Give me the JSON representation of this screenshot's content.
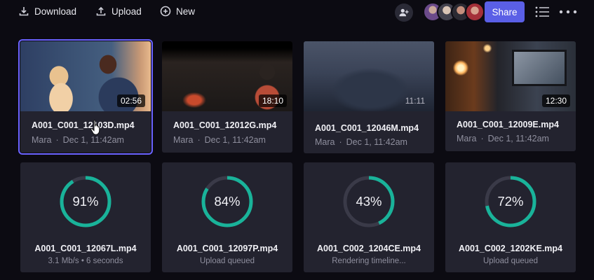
{
  "toolbar": {
    "download_label": "Download",
    "upload_label": "Upload",
    "new_label": "New",
    "share_label": "Share"
  },
  "colors": {
    "accent": "#5a5fe6",
    "progress": "#19b39a",
    "track": "#3a3a48",
    "selection": "#6a62ff"
  },
  "clips": [
    {
      "name": "A001_C001_12103D.mp4",
      "owner": "Mara",
      "date": "Dec 1, 11:42am",
      "duration": "02:56",
      "selected": true
    },
    {
      "name": "A001_C001_12012G.mp4",
      "owner": "Mara",
      "date": "Dec 1, 11:42am",
      "duration": "18:10",
      "selected": false
    },
    {
      "name": "A001_C001_12046M.mp4",
      "owner": "Mara",
      "date": "Dec 1, 11:42am",
      "duration": "11:11",
      "selected": false
    },
    {
      "name": "A001_C001_12009E.mp4",
      "owner": "Mara",
      "date": "Dec 1, 11:42am",
      "duration": "12:30",
      "selected": false
    }
  ],
  "uploads": [
    {
      "name": "A001_C001_12067L.mp4",
      "percent": 91,
      "percent_label": "91%",
      "status": "3.1 Mb/s  •  6 seconds"
    },
    {
      "name": "A001_C001_12097P.mp4",
      "percent": 84,
      "percent_label": "84%",
      "status": "Upload queued"
    },
    {
      "name": "A001_C002_1204CE.mp4",
      "percent": 43,
      "percent_label": "43%",
      "status": "Rendering timeline..."
    },
    {
      "name": "A001_C002_1202KE.mp4",
      "percent": 72,
      "percent_label": "72%",
      "status": "Upload queued"
    }
  ]
}
